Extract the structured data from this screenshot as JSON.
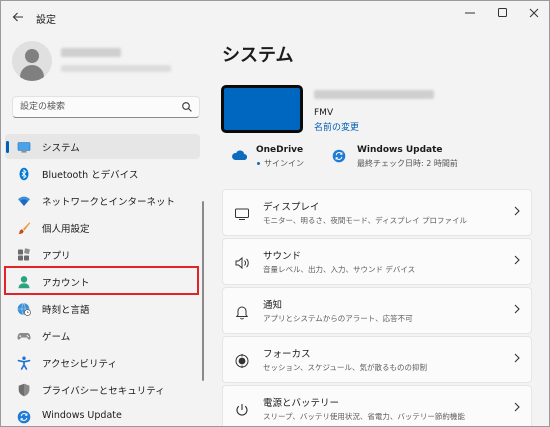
{
  "window": {
    "app_title": "設定"
  },
  "search": {
    "placeholder": "設定の検索"
  },
  "nav": [
    {
      "key": "system",
      "label": "システム"
    },
    {
      "key": "bluetooth",
      "label": "Bluetooth とデバイス"
    },
    {
      "key": "network",
      "label": "ネットワークとインターネット"
    },
    {
      "key": "personalization",
      "label": "個人用設定"
    },
    {
      "key": "apps",
      "label": "アプリ"
    },
    {
      "key": "accounts",
      "label": "アカウント"
    },
    {
      "key": "time-language",
      "label": "時刻と言語"
    },
    {
      "key": "gaming",
      "label": "ゲーム"
    },
    {
      "key": "accessibility",
      "label": "アクセシビリティ"
    },
    {
      "key": "privacy",
      "label": "プライバシーとセキュリティ"
    },
    {
      "key": "windows-update",
      "label": "Windows Update"
    }
  ],
  "main": {
    "title": "システム",
    "device": {
      "model": "FMV",
      "rename_label": "名前の変更"
    },
    "onedrive": {
      "title": "OneDrive",
      "status": "サインイン"
    },
    "windows_update": {
      "title": "Windows Update",
      "status": "最終チェック日時: 2 時間前"
    },
    "cards": [
      {
        "key": "display",
        "title": "ディスプレイ",
        "subtitle": "モニター、明るさ、夜間モード、ディスプレイ プロファイル"
      },
      {
        "key": "sound",
        "title": "サウンド",
        "subtitle": "音量レベル、出力、入力、サウンド デバイス"
      },
      {
        "key": "notifications",
        "title": "通知",
        "subtitle": "アプリとシステムからのアラート、応答不可"
      },
      {
        "key": "focus",
        "title": "フォーカス",
        "subtitle": "セッション、スケジュール、気が散るものの抑制"
      },
      {
        "key": "power",
        "title": "電源とバッテリー",
        "subtitle": "スリープ、バッテリ使用状況、省電力、バッテリー節約機能"
      }
    ]
  },
  "colors": {
    "accent": "#005fb8",
    "highlight": "#e0242b",
    "device_screen": "#0067c0"
  },
  "icons": {
    "back": "arrow-left-icon",
    "minimize": "minimize-icon",
    "maximize": "maximize-icon",
    "close": "close-icon",
    "search": "search-icon",
    "chevron": "chevron-right-icon"
  }
}
